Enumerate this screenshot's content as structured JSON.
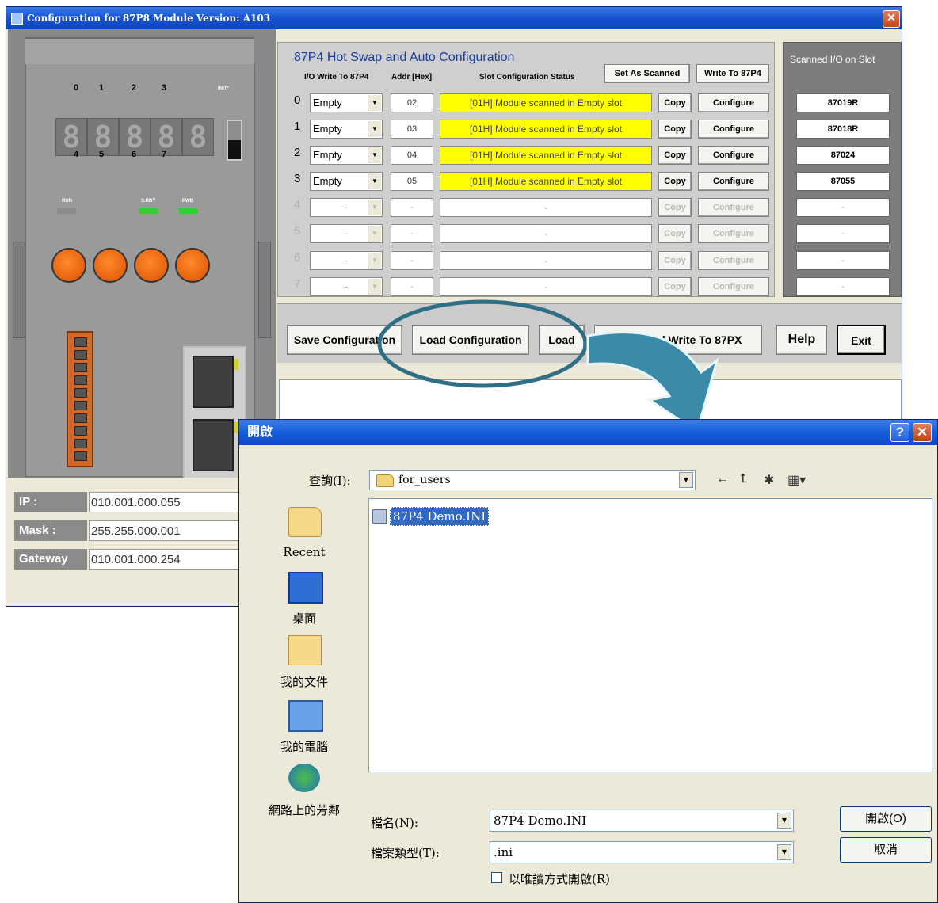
{
  "main_window": {
    "title": "Configuration for 87P8 Module Version: A103",
    "close_glyph": "✕"
  },
  "device": {
    "top_numbers": [
      "0",
      "1",
      "2",
      "3"
    ],
    "bottom_numbers": [
      "4",
      "5",
      "6",
      "7"
    ],
    "init_label": "INIT*",
    "digits": [
      "8",
      "8",
      "8",
      "8",
      "8"
    ],
    "led_labels": [
      "RUN",
      "S.RDY",
      "PWD"
    ],
    "led_colors": [
      "#8c8c8c",
      "#2cd32c",
      "#2cd32c"
    ]
  },
  "network": {
    "ip_label": "IP :",
    "ip_value": "010.001.000.055",
    "mask_label": "Mask :",
    "mask_value": "255.255.000.001",
    "gateway_label": "Gateway",
    "gateway_value": "010.001.000.254"
  },
  "config": {
    "title": "87P4 Hot Swap and Auto Configuration",
    "col_io": "I/O Write To 87P4",
    "col_addr": "Addr [Hex]",
    "col_status": "Slot Configuration Status",
    "set_as_scanned": "Set As Scanned",
    "write_to": "Write To 87P4",
    "copy_label": "Copy",
    "configure_label": "Configure",
    "rows": [
      {
        "num": "0",
        "io": "Empty",
        "addr": "02",
        "status": "[01H] Module scanned in Empty slot",
        "scanned": "87019R"
      },
      {
        "num": "1",
        "io": "Empty",
        "addr": "03",
        "status": "[01H] Module scanned in Empty slot",
        "scanned": "87018R"
      },
      {
        "num": "2",
        "io": "Empty",
        "addr": "04",
        "status": "[01H] Module scanned in Empty slot",
        "scanned": "87024"
      },
      {
        "num": "3",
        "io": "Empty",
        "addr": "05",
        "status": "[01H] Module scanned in Empty slot",
        "scanned": "87055"
      },
      {
        "num": "4",
        "io": "-",
        "addr": "-",
        "status": "-",
        "scanned": "-"
      },
      {
        "num": "5",
        "io": "-",
        "addr": "-",
        "status": "-",
        "scanned": "-"
      },
      {
        "num": "6",
        "io": "-",
        "addr": "-",
        "status": "-",
        "scanned": "-"
      },
      {
        "num": "7",
        "io": "-",
        "addr": "-",
        "status": "-",
        "scanned": "-"
      }
    ]
  },
  "scanned": {
    "title": "Scanned I/O on Slot"
  },
  "buttons": {
    "save": "Save Configuration",
    "load_config": "Load Configuration",
    "load": "Load",
    "scan_write": "Scan And Write To 87PX",
    "help": "Help",
    "exit": "Exit"
  },
  "dialog": {
    "title": "開啟",
    "help_glyph": "?",
    "close_glyph": "✕",
    "lookin_label": "查詢(I):",
    "lookin_value": "for_users",
    "places": [
      "Recent",
      "桌面",
      "我的文件",
      "我的電腦",
      "網路上的芳鄰"
    ],
    "file": "87P4 Demo.INI",
    "filename_label": "檔名(N):",
    "filename_value": "87P4 Demo.INI",
    "filetype_label": "檔案類型(T):",
    "filetype_value": ".ini",
    "readonly_label": "以唯讀方式開啟(R)",
    "open_button": "開啟(O)",
    "cancel_button": "取消"
  },
  "colors": {
    "status_yellow": "#ffff00",
    "titlebar_blue": "#1653cf",
    "annotation_teal": "#2f6f85"
  }
}
